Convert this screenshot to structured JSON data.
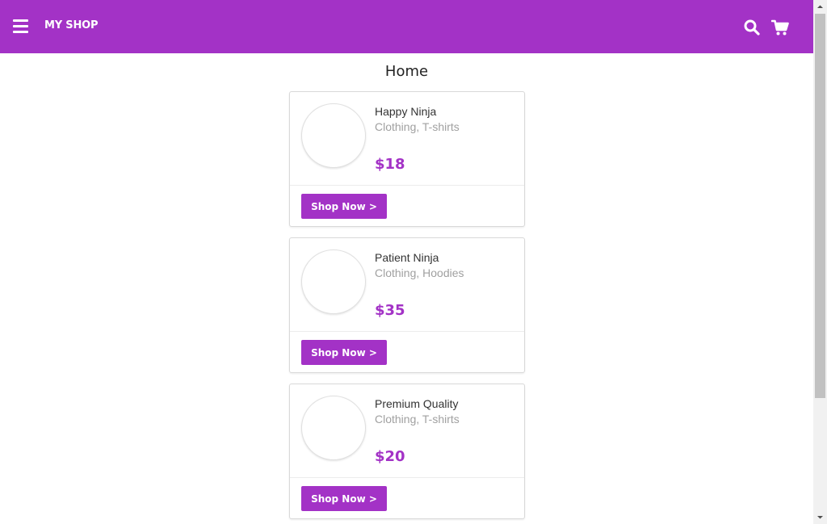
{
  "header": {
    "brand": "MY SHOP",
    "bg_color": "#a332c6",
    "icons": [
      "menu-icon",
      "search-icon",
      "cart-icon"
    ]
  },
  "page": {
    "title": "Home"
  },
  "products": [
    {
      "name": "Happy Ninja",
      "category": "Clothing, T-shirts",
      "price": "$18",
      "button": "Shop Now >"
    },
    {
      "name": "Patient Ninja",
      "category": "Clothing, Hoodies",
      "price": "$35",
      "button": "Shop Now >"
    },
    {
      "name": "Premium Quality",
      "category": "Clothing, T-shirts",
      "price": "$20",
      "button": "Shop Now >"
    }
  ],
  "accent_color": "#a332c6"
}
